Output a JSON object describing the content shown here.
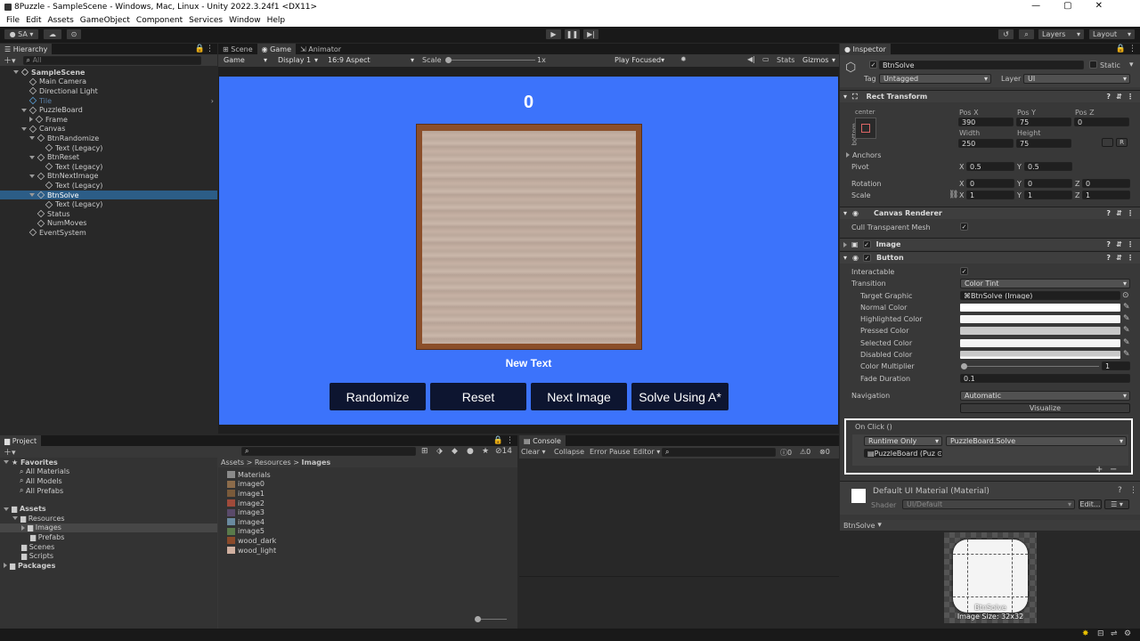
{
  "window": {
    "title": "8Puzzle - SampleScene - Windows, Mac, Linux - Unity 2022.3.24f1 <DX11>"
  },
  "menu": [
    "File",
    "Edit",
    "Assets",
    "GameObject",
    "Component",
    "Services",
    "Window",
    "Help"
  ],
  "toolbar": {
    "account": "SA",
    "layers": "Layers",
    "layout": "Layout"
  },
  "hierarchy": {
    "tab": "Hierarchy",
    "search_placeholder": "All",
    "items": [
      {
        "label": "SampleScene",
        "depth": 0,
        "arrow": "down",
        "icon": "unity-scene-icon"
      },
      {
        "label": "Main Camera",
        "depth": 1,
        "arrow": "",
        "icon": "cube-icon"
      },
      {
        "label": "Directional Light",
        "depth": 1,
        "arrow": "",
        "icon": "cube-icon"
      },
      {
        "label": "Tile",
        "depth": 1,
        "arrow": "",
        "icon": "prefab-icon",
        "dim": true
      },
      {
        "label": "PuzzleBoard",
        "depth": 1,
        "arrow": "down",
        "icon": "cube-icon"
      },
      {
        "label": "Frame",
        "depth": 2,
        "arrow": "right",
        "icon": "cube-icon"
      },
      {
        "label": "Canvas",
        "depth": 1,
        "arrow": "down",
        "icon": "cube-icon"
      },
      {
        "label": "BtnRandomize",
        "depth": 2,
        "arrow": "down",
        "icon": "cube-icon"
      },
      {
        "label": "Text (Legacy)",
        "depth": 3,
        "arrow": "",
        "icon": "cube-icon"
      },
      {
        "label": "BtnReset",
        "depth": 2,
        "arrow": "down",
        "icon": "cube-icon"
      },
      {
        "label": "Text (Legacy)",
        "depth": 3,
        "arrow": "",
        "icon": "cube-icon"
      },
      {
        "label": "BtnNextImage",
        "depth": 2,
        "arrow": "down",
        "icon": "cube-icon"
      },
      {
        "label": "Text (Legacy)",
        "depth": 3,
        "arrow": "",
        "icon": "cube-icon"
      },
      {
        "label": "BtnSolve",
        "depth": 2,
        "arrow": "down",
        "icon": "cube-icon",
        "selected": true
      },
      {
        "label": "Text (Legacy)",
        "depth": 3,
        "arrow": "",
        "icon": "cube-icon"
      },
      {
        "label": "Status",
        "depth": 2,
        "arrow": "",
        "icon": "cube-icon"
      },
      {
        "label": "NumMoves",
        "depth": 2,
        "arrow": "",
        "icon": "cube-icon"
      },
      {
        "label": "EventSystem",
        "depth": 1,
        "arrow": "",
        "icon": "cube-icon"
      }
    ]
  },
  "game": {
    "tabs": [
      "Scene",
      "Game",
      "Animator"
    ],
    "display_mode": "Game",
    "display": "Display 1",
    "aspect": "16:9 Aspect",
    "scale_label": "Scale",
    "scale_value": "1x",
    "play_focused": "Play Focused",
    "stats": "Stats",
    "gizmos": "Gizmos",
    "move_count": "0",
    "status_text": "New Text",
    "buttons": [
      "Randomize",
      "Reset",
      "Next Image",
      "Solve Using A*"
    ],
    "bg_color": "#3c73fb"
  },
  "inspector": {
    "tab": "Inspector",
    "object_name": "BtnSolve",
    "static_label": "Static",
    "tag_label": "Tag",
    "tag": "Untagged",
    "layer_label": "Layer",
    "layer": "UI",
    "rect_transform": {
      "title": "Rect Transform",
      "anchor_h": "center",
      "anchor_v": "bottom",
      "posx_label": "Pos X",
      "posy_label": "Pos Y",
      "posz_label": "Pos Z",
      "posx": "390",
      "posy": "75",
      "posz": "0",
      "width_label": "Width",
      "height_label": "Height",
      "width": "250",
      "height": "75",
      "anchors": "Anchors",
      "pivot": "Pivot",
      "pivot_x": "0.5",
      "pivot_y": "0.5",
      "rotation": "Rotation",
      "rot_x": "0",
      "rot_y": "0",
      "rot_z": "0",
      "scale": "Scale",
      "scale_x": "1",
      "scale_y": "1",
      "scale_z": "1"
    },
    "canvas_renderer": {
      "title": "Canvas Renderer",
      "cull_label": "Cull Transparent Mesh"
    },
    "image": {
      "title": "Image"
    },
    "button": {
      "title": "Button",
      "interactable": "Interactable",
      "transition_label": "Transition",
      "transition": "Color Tint",
      "target_graphic_label": "Target Graphic",
      "target_graphic": "BtnSolve (Image)",
      "normal": "Normal Color",
      "highlighted": "Highlighted Color",
      "pressed": "Pressed Color",
      "selected": "Selected Color",
      "disabled": "Disabled Color",
      "multiplier_label": "Color Multiplier",
      "multiplier": "1",
      "fade_label": "Fade Duration",
      "fade": "0.1",
      "navigation_label": "Navigation",
      "navigation": "Automatic",
      "visualize": "Visualize"
    },
    "onclick": {
      "title": "On Click ()",
      "mode": "Runtime Only",
      "function": "PuzzleBoard.Solve",
      "target": "PuzzleBoard (Puz"
    },
    "material": {
      "name": "Default UI Material (Material)",
      "shader_label": "Shader",
      "shader": "UI/Default",
      "edit": "Edit..."
    },
    "preview": {
      "name": "BtnSolve",
      "caption": "BtnSolve",
      "size": "Image Size: 32x32"
    }
  },
  "project": {
    "tab": "Project",
    "hidden_count": "14",
    "favorites": [
      "Favorites",
      "All Materials",
      "All Models",
      "All Prefabs"
    ],
    "tree": [
      "Assets",
      "Resources",
      "Images",
      "Prefabs",
      "Scenes",
      "Scripts",
      "Packages"
    ],
    "breadcrumb": [
      "Assets",
      "Resources",
      "Images"
    ],
    "files": [
      "Materials",
      "image0",
      "image1",
      "image2",
      "image3",
      "image4",
      "image5",
      "wood_dark",
      "wood_light"
    ]
  },
  "console": {
    "tab": "Console",
    "clear": "Clear",
    "collapse": "Collapse",
    "error_pause": "Error Pause",
    "editor": "Editor",
    "log_count": "0",
    "warn_count": "0",
    "err_count": "0"
  }
}
